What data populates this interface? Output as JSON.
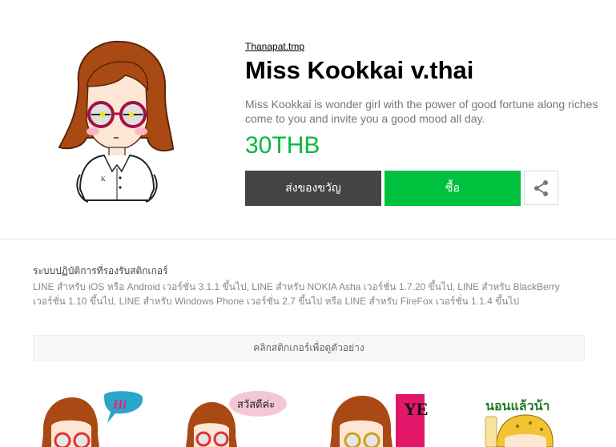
{
  "sticker": {
    "author": "Thanapat.tmp",
    "title": "Miss Kookkai v.thai",
    "description": "Miss Kookkai is wonder girl with the power of good fortune along riches come to you and invite you a good mood all day.",
    "price": "30THB",
    "gift_label": "ส่งของขวัญ",
    "buy_label": "ซื้อ",
    "share_icon": "share-icon",
    "main_image_shirt_letter": "K"
  },
  "supported": {
    "heading": "ระบบปฏิบัติการที่รองรับสติกเกอร์",
    "text": "LINE สำหรับ iOS หรือ Android เวอร์ชั่น 3.1.1 ขึ้นไป, LINE สำหรับ NOKIA Asha เวอร์ชั่น 1.7.20 ขึ้นไป, LINE สำหรับ BlackBerry เวอร์ชั่น 1.10 ขึ้นไป, LINE สำหรับ Windows Phone เวอร์ชั่น 2.7 ขึ้นไป หรือ LINE สำหรับ FireFox เวอร์ชั่น 1.1.4 ขึ้นไป"
  },
  "preview": {
    "label": "คลิกสติกเกอร์เพื่อดูตัวอย่าง"
  },
  "stickers": [
    {
      "text": "Hi"
    },
    {
      "text": "สวัสดีค่ะ"
    },
    {
      "text": "YE"
    },
    {
      "text": "นอนแล้วน้า"
    }
  ],
  "colors": {
    "price": "#08b842",
    "buy_button": "#00c13e",
    "gift_button": "#444444"
  }
}
